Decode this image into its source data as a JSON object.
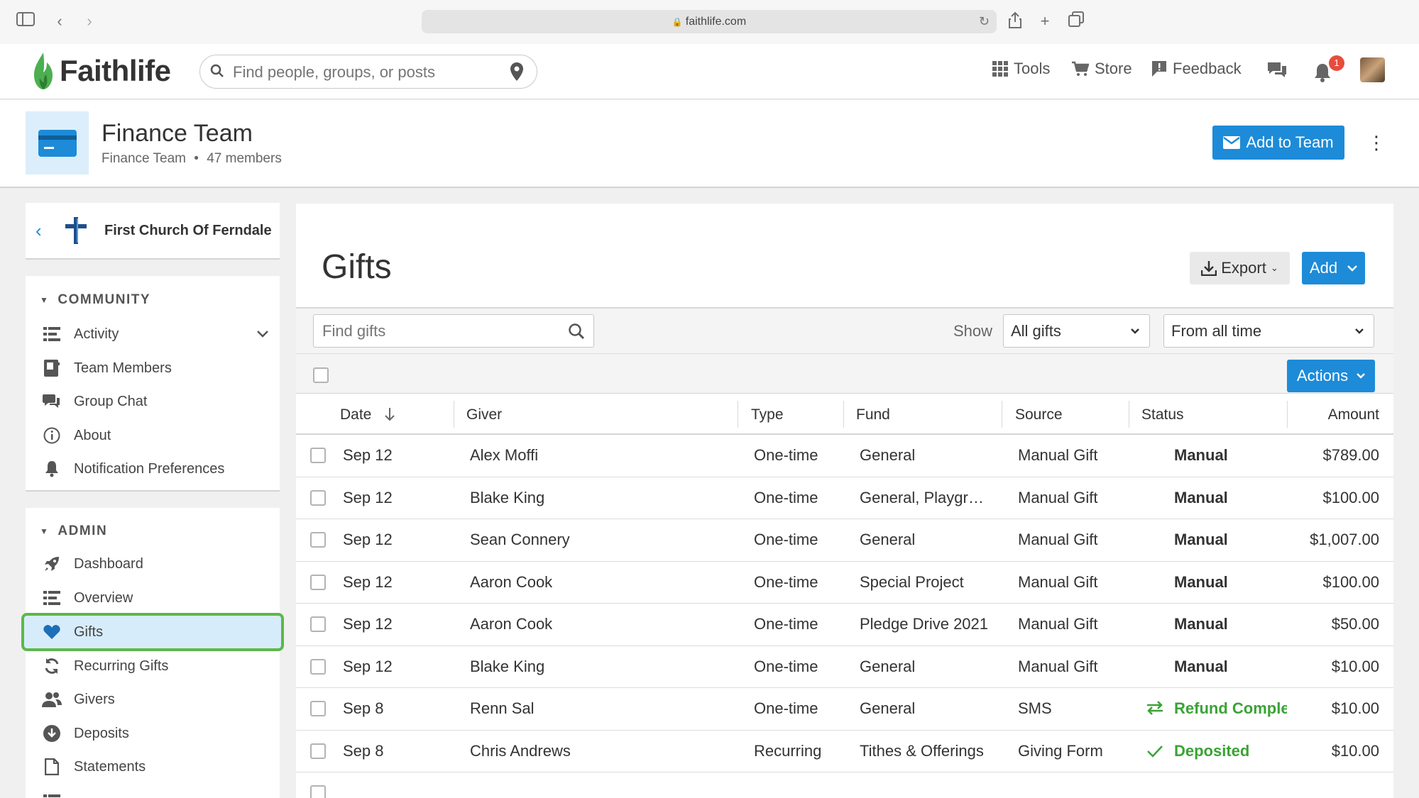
{
  "browser": {
    "url": "faithlife.com"
  },
  "header": {
    "brand": "Faithlife",
    "search_placeholder": "Find people, groups, or posts",
    "nav": {
      "tools": "Tools",
      "store": "Store",
      "feedback": "Feedback"
    },
    "notification_count": "1"
  },
  "team": {
    "title": "Finance Team",
    "subtitle_name": "Finance Team",
    "separator": "•",
    "member_count": "47 members",
    "add_button": "Add to Team"
  },
  "sidebar": {
    "org_name": "First Church Of Ferndale",
    "community_heading": "COMMUNITY",
    "community_items": [
      {
        "label": "Activity",
        "icon": "list-icon"
      },
      {
        "label": "Team Members",
        "icon": "address-book-icon"
      },
      {
        "label": "Group Chat",
        "icon": "chat-bubbles-icon"
      },
      {
        "label": "About",
        "icon": "info-icon"
      },
      {
        "label": "Notification Preferences",
        "icon": "bell-icon"
      }
    ],
    "admin_heading": "ADMIN",
    "admin_items": [
      {
        "label": "Dashboard",
        "icon": "rocket-icon"
      },
      {
        "label": "Overview",
        "icon": "list-icon"
      },
      {
        "label": "Gifts",
        "icon": "heart-icon",
        "active": true
      },
      {
        "label": "Recurring Gifts",
        "icon": "recurring-icon"
      },
      {
        "label": "Givers",
        "icon": "people-icon"
      },
      {
        "label": "Deposits",
        "icon": "deposit-icon"
      },
      {
        "label": "Statements",
        "icon": "document-icon"
      }
    ]
  },
  "main": {
    "title": "Gifts",
    "export_label": "Export",
    "add_label": "Add",
    "find_placeholder": "Find gifts",
    "show_label": "Show",
    "show_value": "All gifts",
    "time_value": "From all time",
    "actions_label": "Actions",
    "columns": [
      "Date",
      "Giver",
      "Type",
      "Fund",
      "Source",
      "Status",
      "Amount"
    ],
    "rows": [
      {
        "date": "Sep 12",
        "giver": "Alex Moffi",
        "type": "One-time",
        "fund": "General",
        "source": "Manual Gift",
        "status": "Manual",
        "amount": "$789.00"
      },
      {
        "date": "Sep 12",
        "giver": "Blake King",
        "type": "One-time",
        "fund": "General, Playgr…",
        "source": "Manual Gift",
        "status": "Manual",
        "amount": "$100.00"
      },
      {
        "date": "Sep 12",
        "giver": "Sean Connery",
        "type": "One-time",
        "fund": "General",
        "source": "Manual Gift",
        "status": "Manual",
        "amount": "$1,007.00"
      },
      {
        "date": "Sep 12",
        "giver": "Aaron Cook",
        "type": "One-time",
        "fund": "Special Project",
        "source": "Manual Gift",
        "status": "Manual",
        "amount": "$100.00"
      },
      {
        "date": "Sep 12",
        "giver": "Aaron Cook",
        "type": "One-time",
        "fund": "Pledge Drive 2021",
        "source": "Manual Gift",
        "status": "Manual",
        "amount": "$50.00"
      },
      {
        "date": "Sep 12",
        "giver": "Blake King",
        "type": "One-time",
        "fund": "General",
        "source": "Manual Gift",
        "status": "Manual",
        "amount": "$10.00"
      },
      {
        "date": "Sep 8",
        "giver": "Renn Sal",
        "type": "One-time",
        "fund": "General",
        "source": "SMS",
        "status": "Refund Complete",
        "amount": "$10.00"
      },
      {
        "date": "Sep 8",
        "giver": "Chris Andrews",
        "type": "Recurring",
        "fund": "Tithes & Offerings",
        "source": "Giving Form",
        "status": "Deposited",
        "amount": "$10.00"
      }
    ]
  },
  "colors": {
    "accent": "#1d8bd8",
    "highlight_border": "#5cb84a",
    "status_green": "#3aa335"
  }
}
